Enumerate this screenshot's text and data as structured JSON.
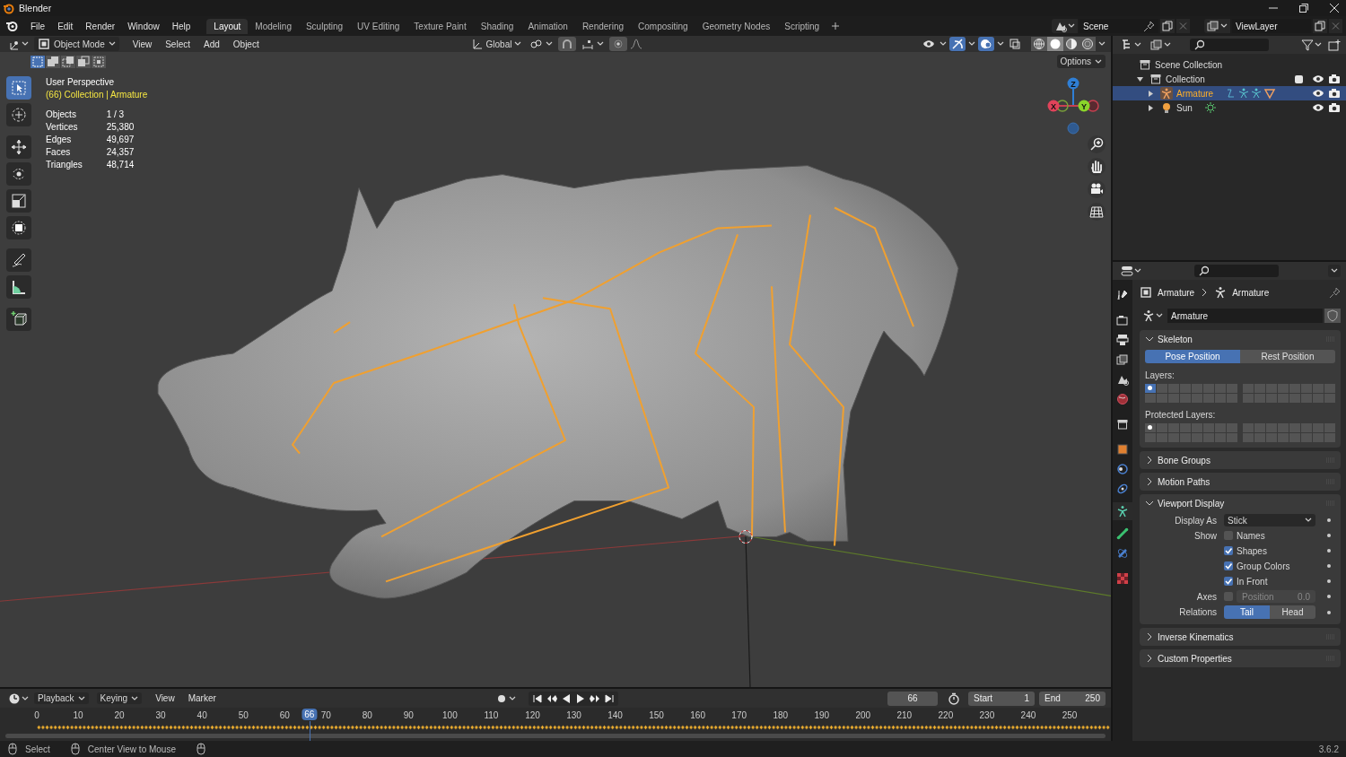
{
  "window": {
    "title": "Blender"
  },
  "menu": [
    "File",
    "Edit",
    "Render",
    "Window",
    "Help"
  ],
  "workspaces": [
    {
      "label": "Layout",
      "selected": true
    },
    {
      "label": "Modeling",
      "selected": false
    },
    {
      "label": "Sculpting",
      "selected": false
    },
    {
      "label": "UV Editing",
      "selected": false
    },
    {
      "label": "Texture Paint",
      "selected": false
    },
    {
      "label": "Shading",
      "selected": false
    },
    {
      "label": "Animation",
      "selected": false
    },
    {
      "label": "Rendering",
      "selected": false
    },
    {
      "label": "Compositing",
      "selected": false
    },
    {
      "label": "Geometry Nodes",
      "selected": false
    },
    {
      "label": "Scripting",
      "selected": false
    }
  ],
  "scene": {
    "name": "Scene"
  },
  "view_layer": {
    "name": "ViewLayer"
  },
  "viewport": {
    "mode": "Object Mode",
    "menus": [
      "View",
      "Select",
      "Add",
      "Object"
    ],
    "orientation": "Global",
    "toggles": [
      {
        "kind": "visibility",
        "on": false
      },
      {
        "kind": "gizmo",
        "on": true
      },
      {
        "kind": "overlay",
        "on": true
      },
      {
        "kind": "xray",
        "on": false
      }
    ],
    "shading": [
      {
        "kind": "wireframe",
        "selected": false
      },
      {
        "kind": "solid",
        "selected": true
      },
      {
        "kind": "material",
        "selected": false
      },
      {
        "kind": "rendered",
        "selected": false
      }
    ],
    "select_modes": [
      {
        "kind": "new",
        "selected": true
      },
      {
        "kind": "extend",
        "selected": false
      },
      {
        "kind": "subtract",
        "selected": false
      },
      {
        "kind": "invert",
        "selected": false
      },
      {
        "kind": "intersect",
        "selected": false
      }
    ],
    "options": "Options",
    "view_name": "User Perspective",
    "context": "(66) Collection | Armature",
    "stats": [
      {
        "label": "Objects",
        "value": "1 / 3"
      },
      {
        "label": "Vertices",
        "value": "25,380"
      },
      {
        "label": "Edges",
        "value": "49,697"
      },
      {
        "label": "Faces",
        "value": "24,357"
      },
      {
        "label": "Triangles",
        "value": "48,714"
      }
    ],
    "tools": [
      {
        "kind": "select",
        "selected": true
      },
      {
        "kind": "cursor",
        "selected": false
      },
      {
        "kind": "move",
        "selected": false
      },
      {
        "kind": "rotate",
        "selected": false
      },
      {
        "kind": "scale",
        "selected": false
      },
      {
        "kind": "transform",
        "selected": false
      },
      {
        "kind": "annotate",
        "selected": false
      },
      {
        "kind": "measure",
        "selected": false
      },
      {
        "kind": "add_cube",
        "selected": false
      }
    ],
    "gizmo": {
      "x": "X",
      "y": "Y",
      "z": "Z"
    }
  },
  "outliner": {
    "items": [
      {
        "label": "Scene Collection",
        "kind": "scene_collection",
        "children": [
          {
            "label": "Collection",
            "kind": "collection",
            "expanded": true,
            "checked": true,
            "selected": false,
            "children": [
              {
                "label": "Armature",
                "kind": "armature",
                "expanded": false,
                "selected": true
              },
              {
                "label": "Sun",
                "kind": "light",
                "expanded": false,
                "selected": false
              }
            ]
          }
        ]
      }
    ]
  },
  "properties": {
    "breadcrumb": [
      "Armature",
      "Armature"
    ],
    "data_name": "Armature",
    "tabs": [
      {
        "kind": "tool",
        "selected": false
      },
      {
        "kind": "render",
        "selected": false
      },
      {
        "kind": "output",
        "selected": false
      },
      {
        "kind": "view_layer",
        "selected": false
      },
      {
        "kind": "scene",
        "selected": false
      },
      {
        "kind": "world",
        "selected": false
      },
      {
        "kind": "collection",
        "selected": false
      },
      {
        "kind": "object",
        "selected": false
      },
      {
        "kind": "physics",
        "selected": false
      },
      {
        "kind": "constraints",
        "selected": false
      },
      {
        "kind": "data",
        "selected": true
      },
      {
        "kind": "bone",
        "selected": false
      },
      {
        "kind": "bone_constraints",
        "selected": false
      },
      {
        "kind": "texture",
        "selected": false
      }
    ],
    "panels": [
      {
        "kind": "skeleton",
        "title": "Skeleton",
        "expanded": true,
        "positions": [
          {
            "label": "Pose Position",
            "selected": true
          },
          {
            "label": "Rest Position",
            "selected": false
          }
        ],
        "layers_label": "Layers:",
        "layers": [
          {
            "on": true,
            "has_bones": true
          },
          {
            "on": false,
            "has_bones": false
          },
          {
            "on": false,
            "has_bones": false
          },
          {
            "on": false,
            "has_bones": false
          },
          {
            "on": false,
            "has_bones": false
          },
          {
            "on": false,
            "has_bones": false
          },
          {
            "on": false,
            "has_bones": false
          },
          {
            "on": false,
            "has_bones": false
          },
          {
            "on": false,
            "has_bones": false
          },
          {
            "on": false,
            "has_bones": false
          },
          {
            "on": false,
            "has_bones": false
          },
          {
            "on": false,
            "has_bones": false
          },
          {
            "on": false,
            "has_bones": false
          },
          {
            "on": false,
            "has_bones": false
          },
          {
            "on": false,
            "has_bones": false
          },
          {
            "on": false,
            "has_bones": false
          },
          {
            "on": false,
            "has_bones": false
          },
          {
            "on": false,
            "has_bones": false
          },
          {
            "on": false,
            "has_bones": false
          },
          {
            "on": false,
            "has_bones": false
          },
          {
            "on": false,
            "has_bones": false
          },
          {
            "on": false,
            "has_bones": false
          },
          {
            "on": false,
            "has_bones": false
          },
          {
            "on": false,
            "has_bones": false
          },
          {
            "on": false,
            "has_bones": false
          },
          {
            "on": false,
            "has_bones": false
          },
          {
            "on": false,
            "has_bones": false
          },
          {
            "on": false,
            "has_bones": false
          },
          {
            "on": false,
            "has_bones": false
          },
          {
            "on": false,
            "has_bones": false
          },
          {
            "on": false,
            "has_bones": false
          },
          {
            "on": false,
            "has_bones": false
          }
        ],
        "protected_label": "Protected Layers:",
        "protected": [
          {
            "on": false,
            "has_bones": true
          },
          {
            "on": false,
            "has_bones": false
          },
          {
            "on": false,
            "has_bones": false
          },
          {
            "on": false,
            "has_bones": false
          },
          {
            "on": false,
            "has_bones": false
          },
          {
            "on": false,
            "has_bones": false
          },
          {
            "on": false,
            "has_bones": false
          },
          {
            "on": false,
            "has_bones": false
          },
          {
            "on": false,
            "has_bones": false
          },
          {
            "on": false,
            "has_bones": false
          },
          {
            "on": false,
            "has_bones": false
          },
          {
            "on": false,
            "has_bones": false
          },
          {
            "on": false,
            "has_bones": false
          },
          {
            "on": false,
            "has_bones": false
          },
          {
            "on": false,
            "has_bones": false
          },
          {
            "on": false,
            "has_bones": false
          },
          {
            "on": false,
            "has_bones": false
          },
          {
            "on": false,
            "has_bones": false
          },
          {
            "on": false,
            "has_bones": false
          },
          {
            "on": false,
            "has_bones": false
          },
          {
            "on": false,
            "has_bones": false
          },
          {
            "on": false,
            "has_bones": false
          },
          {
            "on": false,
            "has_bones": false
          },
          {
            "on": false,
            "has_bones": false
          },
          {
            "on": false,
            "has_bones": false
          },
          {
            "on": false,
            "has_bones": false
          },
          {
            "on": false,
            "has_bones": false
          },
          {
            "on": false,
            "has_bones": false
          },
          {
            "on": false,
            "has_bones": false
          },
          {
            "on": false,
            "has_bones": false
          },
          {
            "on": false,
            "has_bones": false
          },
          {
            "on": false,
            "has_bones": false
          }
        ]
      },
      {
        "title": "Bone Groups",
        "expanded": false
      },
      {
        "title": "Motion Paths",
        "expanded": false
      },
      {
        "kind": "display",
        "title": "Viewport Display",
        "expanded": true,
        "rows": [
          {
            "kind": "dropdown",
            "label": "Display As",
            "value": "Stick"
          },
          {
            "kind": "checkbox",
            "label": "Show",
            "text": "Names",
            "checked": false
          },
          {
            "kind": "checkbox",
            "text": "Shapes",
            "checked": true
          },
          {
            "kind": "checkbox",
            "text": "Group Colors",
            "checked": true
          },
          {
            "kind": "checkbox",
            "text": "In Front",
            "checked": true
          },
          {
            "kind": "axes",
            "label": "Axes",
            "checked": false,
            "field_label": "Position",
            "field_value": "0.0",
            "disabled": true
          },
          {
            "kind": "segmented",
            "label": "Relations",
            "options": [
              {
                "label": "Tail",
                "selected": true
              },
              {
                "label": "Head",
                "selected": false
              }
            ]
          }
        ]
      },
      {
        "title": "Inverse Kinematics",
        "expanded": false
      },
      {
        "title": "Custom Properties",
        "expanded": false
      }
    ]
  },
  "timeline": {
    "menus": [
      {
        "label": "Playback",
        "dropdown": true
      },
      {
        "label": "Keying",
        "dropdown": true
      },
      {
        "label": "View",
        "dropdown": false
      },
      {
        "label": "Marker",
        "dropdown": false
      }
    ],
    "current_frame": "66",
    "start_label": "Start",
    "start": "1",
    "end_label": "End",
    "end": "250",
    "ticks": [
      "0",
      "10",
      "20",
      "30",
      "40",
      "50",
      "60",
      "70",
      "80",
      "90",
      "100",
      "110",
      "120",
      "130",
      "140",
      "150",
      "160",
      "170",
      "180",
      "190",
      "200",
      "210",
      "220",
      "230",
      "240",
      "250"
    ],
    "playhead": {
      "label": "66",
      "level": 0.264
    }
  },
  "status_bar": {
    "hints": [
      "Select",
      "Center View to Mouse"
    ],
    "version": "3.6.2"
  }
}
